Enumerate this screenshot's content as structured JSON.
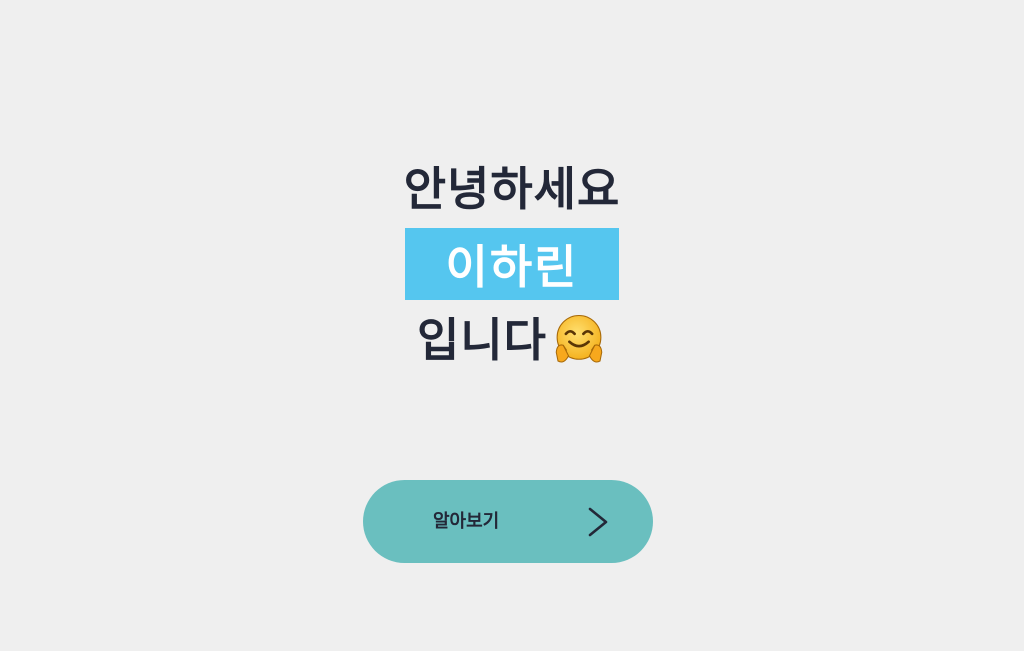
{
  "greeting": {
    "line1": "안녕하세요",
    "name": "이하린",
    "line3": "입니다",
    "emoji_icon": "hugging-face-emoji"
  },
  "cta": {
    "label": "알아보기",
    "icon": "chevron-right-icon"
  },
  "colors": {
    "background": "#efefef",
    "text": "#232838",
    "name_highlight": "#55c6ef",
    "button": "#6abfbf"
  }
}
